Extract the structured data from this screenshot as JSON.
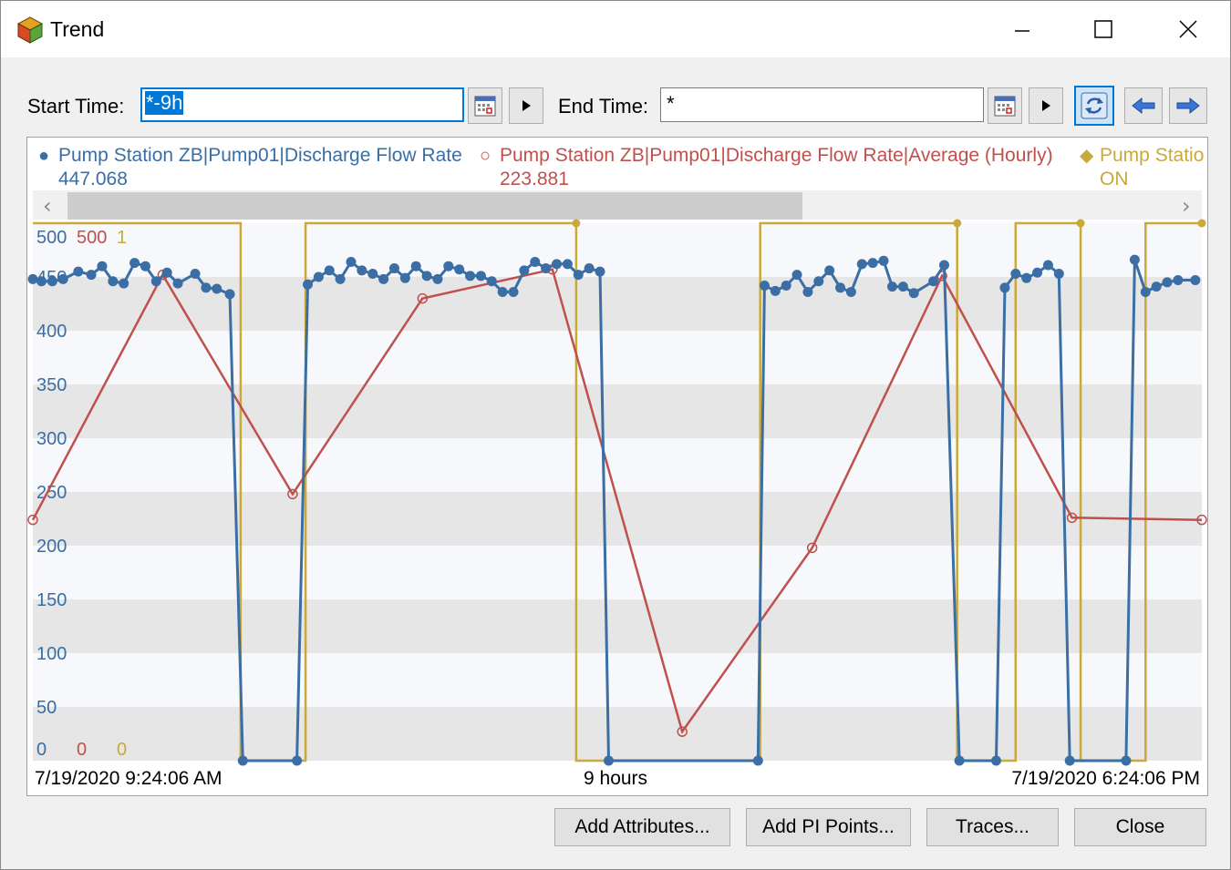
{
  "window": {
    "title": "Trend"
  },
  "toolbar": {
    "start_label": "Start Time:",
    "start_value": "*-9h",
    "end_label": "End Time:",
    "end_value": "*"
  },
  "legend": [
    {
      "name": "Pump Station ZB|Pump01|Discharge Flow Rate",
      "value": "447.068",
      "color": "#3a6ea5",
      "marker": "●"
    },
    {
      "name": "Pump Station ZB|Pump01|Discharge Flow Rate|Average (Hourly)",
      "value": "223.881",
      "color": "#c0504d",
      "marker": "○"
    },
    {
      "name": "Pump Statio",
      "value": "ON",
      "color": "#c9a93a",
      "marker": "◆"
    }
  ],
  "scroll": {
    "left_arrow": "‹",
    "right_arrow": "›"
  },
  "axis": {
    "scale_tops": [
      "500",
      "500",
      "1"
    ],
    "scale_bottoms": [
      "0",
      "0",
      "0"
    ],
    "y_ticks": [
      "450",
      "400",
      "350",
      "300",
      "250",
      "200",
      "150",
      "100",
      "50"
    ],
    "start_time": "7/19/2020 9:24:06 AM",
    "span": "9 hours",
    "end_time": "7/19/2020 6:24:06 PM"
  },
  "buttons": {
    "add_attributes": "Add Attributes...",
    "add_pi_points": "Add PI Points...",
    "traces": "Traces...",
    "close": "Close"
  },
  "chart_data": {
    "type": "line",
    "xlim": [
      0,
      540
    ],
    "ylim": [
      0,
      500
    ],
    "series": [
      {
        "name": "Pump Station ZB|Pump01|Discharge Flow Rate",
        "color": "#3a6ea5",
        "points": [
          [
            0,
            448
          ],
          [
            4,
            446
          ],
          [
            9,
            446
          ],
          [
            14,
            448
          ],
          [
            21,
            455
          ],
          [
            27,
            452
          ],
          [
            32,
            460
          ],
          [
            37,
            446
          ],
          [
            42,
            444
          ],
          [
            47,
            463
          ],
          [
            52,
            460
          ],
          [
            57,
            446
          ],
          [
            62,
            454
          ],
          [
            67,
            444
          ],
          [
            75,
            453
          ],
          [
            80,
            440
          ],
          [
            85,
            439
          ],
          [
            91,
            434
          ],
          [
            97,
            0
          ],
          [
            122,
            0
          ],
          [
            127,
            443
          ],
          [
            132,
            450
          ],
          [
            137,
            456
          ],
          [
            142,
            448
          ],
          [
            147,
            464
          ],
          [
            152,
            456
          ],
          [
            157,
            453
          ],
          [
            162,
            448
          ],
          [
            167,
            458
          ],
          [
            172,
            449
          ],
          [
            177,
            460
          ],
          [
            182,
            451
          ],
          [
            187,
            448
          ],
          [
            192,
            460
          ],
          [
            197,
            457
          ],
          [
            202,
            451
          ],
          [
            207,
            451
          ],
          [
            212,
            446
          ],
          [
            217,
            436
          ],
          [
            222,
            436
          ],
          [
            227,
            456
          ],
          [
            232,
            464
          ],
          [
            237,
            458
          ],
          [
            242,
            462
          ],
          [
            247,
            462
          ],
          [
            252,
            452
          ],
          [
            257,
            458
          ],
          [
            262,
            455
          ],
          [
            266,
            0
          ],
          [
            335,
            0
          ],
          [
            338,
            442
          ],
          [
            343,
            437
          ],
          [
            348,
            442
          ],
          [
            353,
            452
          ],
          [
            358,
            436
          ],
          [
            363,
            446
          ],
          [
            368,
            456
          ],
          [
            373,
            440
          ],
          [
            378,
            436
          ],
          [
            383,
            462
          ],
          [
            388,
            463
          ],
          [
            393,
            465
          ],
          [
            397,
            441
          ],
          [
            402,
            441
          ],
          [
            407,
            435
          ],
          [
            416,
            446
          ],
          [
            421,
            461
          ],
          [
            428,
            0
          ],
          [
            445,
            0
          ],
          [
            449,
            440
          ],
          [
            454,
            453
          ],
          [
            459,
            449
          ],
          [
            464,
            454
          ],
          [
            469,
            461
          ],
          [
            474,
            453
          ],
          [
            479,
            0
          ],
          [
            505,
            0
          ],
          [
            509,
            466
          ],
          [
            514,
            436
          ],
          [
            519,
            441
          ],
          [
            524,
            445
          ],
          [
            529,
            447
          ],
          [
            537,
            447
          ]
        ]
      },
      {
        "name": "Pump Station ZB|Pump01|Discharge Flow Rate|Average (Hourly)",
        "color": "#c0504d",
        "points": [
          [
            0,
            224
          ],
          [
            60,
            452
          ],
          [
            120,
            248
          ],
          [
            180,
            430
          ],
          [
            240,
            457
          ],
          [
            300,
            27
          ],
          [
            360,
            198
          ],
          [
            420,
            451
          ],
          [
            480,
            226
          ],
          [
            540,
            224
          ]
        ]
      },
      {
        "name": "Pump Statio",
        "color": "#c9a93a",
        "step": true,
        "points": [
          [
            0,
            1
          ],
          [
            96,
            1
          ],
          [
            96,
            0
          ],
          [
            126,
            0
          ],
          [
            126,
            1
          ],
          [
            251,
            1
          ],
          [
            251,
            0
          ],
          [
            336,
            0
          ],
          [
            336,
            1
          ],
          [
            427,
            1
          ],
          [
            427,
            0
          ],
          [
            454,
            0
          ],
          [
            454,
            1
          ],
          [
            484,
            1
          ],
          [
            484,
            0
          ],
          [
            514,
            0
          ],
          [
            514,
            1
          ],
          [
            540,
            1
          ]
        ]
      }
    ]
  }
}
